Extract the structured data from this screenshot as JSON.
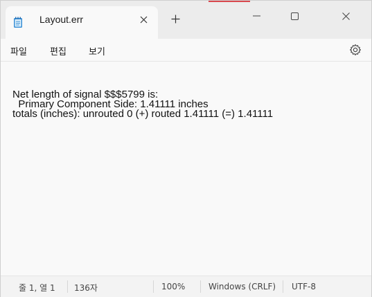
{
  "tab": {
    "title": "Layout.err",
    "icon": "notepad-icon"
  },
  "window_controls": {
    "minimize_icon": "minimize-icon",
    "maximize_icon": "maximize-icon",
    "close_icon": "close-icon"
  },
  "menu": {
    "file": "파일",
    "edit": "편집",
    "view": "보기",
    "settings_icon": "gear-icon"
  },
  "document": {
    "lines": [
      "Net length of signal $$$5799 is:",
      "  Primary Component Side: 1.41111 inches",
      "totals (inches): unrouted 0 (+) routed 1.41111 (=) 1.41111"
    ]
  },
  "status": {
    "position": "줄 1, 열 1",
    "char_count": "136자",
    "zoom": "100%",
    "line_ending": "Windows (CRLF)",
    "encoding": "UTF-8"
  },
  "colors": {
    "accent": "#d9484d",
    "tab_bar": "#ececec",
    "editor_bg": "#f9f9f9"
  }
}
